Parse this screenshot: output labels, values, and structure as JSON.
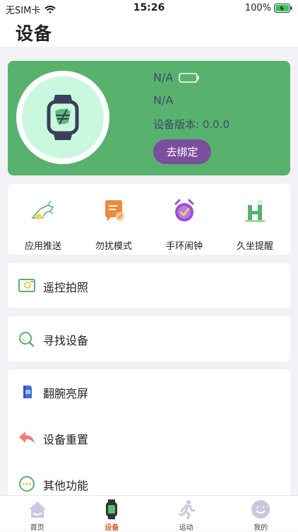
{
  "status_bar": {
    "carrier": "无SIM卡",
    "time": "15:26",
    "battery": "100%"
  },
  "header": {
    "title": "设备"
  },
  "device": {
    "name": "N/A",
    "mac": "N/A",
    "version": "设备版本: 0.0.0",
    "unbind_label": "去绑定"
  },
  "functions": [
    {
      "label": "应用推送",
      "icon": "hand-watch-icon"
    },
    {
      "label": "勿扰模式",
      "icon": "dnd-note-icon"
    },
    {
      "label": "手环闹钟",
      "icon": "alarm-clock-icon"
    },
    {
      "label": "久坐提醒",
      "icon": "sedentary-icon"
    }
  ],
  "menu": {
    "remote_photo": "遥控拍照",
    "find_device": "寻找设备",
    "wrist_bright": "翻腕亮屏",
    "device_reset": "设备重置",
    "other_functions": "其他功能"
  },
  "tabs": [
    {
      "label": "首页"
    },
    {
      "label": "设备",
      "active": true
    },
    {
      "label": "运动"
    },
    {
      "label": "我的"
    }
  ],
  "colors": {
    "card_green": "#58b26e",
    "button_purple": "#7b4e9e",
    "active_tab": "#e4572e"
  }
}
